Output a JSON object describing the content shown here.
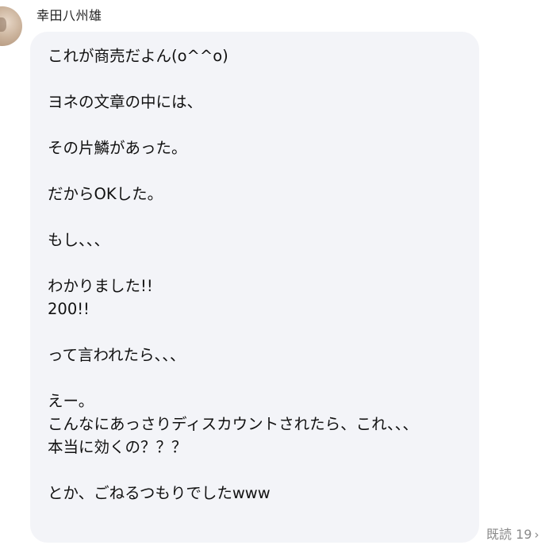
{
  "sender": {
    "name": "幸田八州雄"
  },
  "message": {
    "lines": [
      "これが商売だよん(o^^o)",
      "",
      "ヨネの文章の中には、",
      "",
      "その片鱗があった。",
      "",
      "だからOKした。",
      "",
      "もし、、、",
      "",
      "わかりました!!",
      "200!!",
      "",
      "って言われたら、、、",
      "",
      "えー。",
      "こんなにあっさりディスカウントされたら、これ、、、",
      "本当に効くの？？？",
      "",
      "とか、ごねるつもりでしたwww"
    ]
  },
  "status": {
    "read_label": "既読 19",
    "chevron_icon": "chevron-right-icon"
  },
  "colors": {
    "bubble": "#f3f4f8",
    "read_text": "#8a8a8a"
  }
}
